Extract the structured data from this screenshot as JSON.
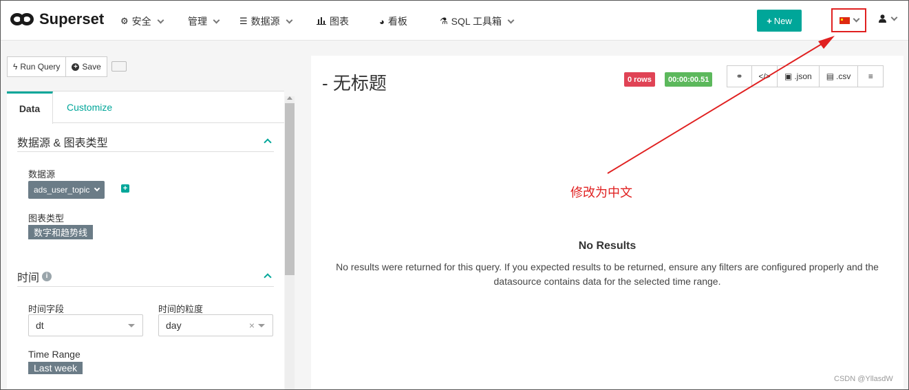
{
  "navbar": {
    "brand": "Superset",
    "items": [
      {
        "label": "安全",
        "icon": "security-icon",
        "dropdown": true
      },
      {
        "label": "管理",
        "icon": "",
        "dropdown": true
      },
      {
        "label": "数据源",
        "icon": "database-icon",
        "dropdown": true
      },
      {
        "label": "图表",
        "icon": "bar-chart-icon",
        "dropdown": false
      },
      {
        "label": "看板",
        "icon": "dashboard-icon",
        "dropdown": false
      },
      {
        "label": "SQL 工具箱",
        "icon": "flask-icon",
        "dropdown": true
      }
    ],
    "new_label": "New",
    "new_color": "#00a699",
    "language": "中文"
  },
  "toolbar": {
    "run_query": "Run Query",
    "save": "Save"
  },
  "tabs": {
    "data": "Data",
    "customize": "Customize"
  },
  "datasource_section": {
    "title": "数据源 & 图表类型",
    "datasource_label": "数据源",
    "datasource_value": "ads_user_topic",
    "charttype_label": "图表类型",
    "charttype_value": "数字和趋势线"
  },
  "time_section": {
    "title": "时间",
    "time_column_label": "时间字段",
    "time_column_value": "dt",
    "time_grain_label": "时间的粒度",
    "time_grain_value": "day",
    "time_range_label": "Time Range",
    "time_range_value": "Last week"
  },
  "result": {
    "title": "- 无标题",
    "rows_badge": "0 rows",
    "timer_badge": "00:00:00.51",
    "json_label": ".json",
    "csv_label": ".csv",
    "no_results_title": "No Results",
    "no_results_message": "No results were returned for this query. If you expected results to be returned, ensure any filters are configured properly and the datasource contains data for the selected time range."
  },
  "annotation": "修改为中文",
  "watermark": "CSDN @YllasdW",
  "colors": {
    "accent": "#00a699",
    "danger": "#e04355",
    "success": "#5cb85c",
    "annotation": "#e02020"
  }
}
